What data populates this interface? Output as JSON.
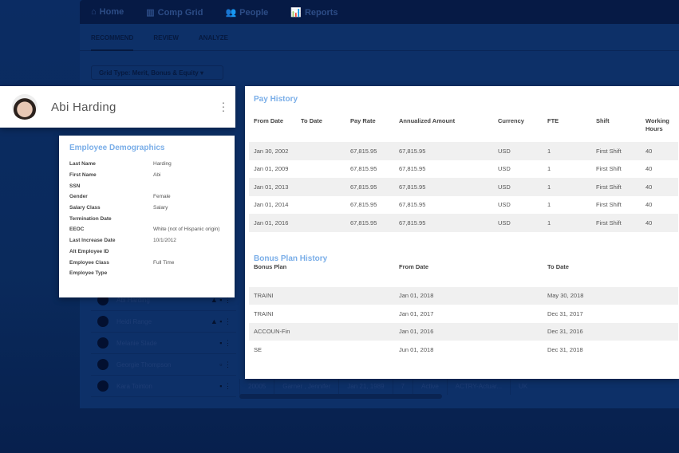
{
  "nav": {
    "items": [
      {
        "icon": "home-icon",
        "label": "Home"
      },
      {
        "icon": "grid-icon",
        "label": "Comp Grid"
      },
      {
        "icon": "people-icon",
        "label": "People"
      },
      {
        "icon": "reports-icon",
        "label": "Reports"
      }
    ]
  },
  "tabs": [
    "RECOMMEND",
    "REVIEW",
    "ANALYZE"
  ],
  "grid_type": "Grid Type: Merit, Bonus & Equity",
  "background_list": [
    "Abi Harding",
    "Heidi Range",
    "Melanie Slade",
    "Georgie Thompson",
    "Kara Tointon"
  ],
  "background_row": [
    "20005",
    "Garner , Jennifer",
    "Jan 21, 1989",
    "7",
    "Active",
    "ACTRY-Actuar...",
    "UK"
  ],
  "profile": {
    "name": "Abi Harding"
  },
  "demographics": {
    "title": "Employee Demographics",
    "rows": [
      {
        "label": "Last Name",
        "value": "Harding"
      },
      {
        "label": "First Name",
        "value": "Abi"
      },
      {
        "label": "SSN",
        "value": ""
      },
      {
        "label": "Gender",
        "value": "Female"
      },
      {
        "label": "Salary Class",
        "value": "Salary"
      },
      {
        "label": "Termination Date",
        "value": ""
      },
      {
        "label": "EEOC",
        "value": "White (not of Hispanic origin)"
      },
      {
        "label": "Last Increase Date",
        "value": "10/1/2012"
      },
      {
        "label": "Alt Employee ID",
        "value": ""
      },
      {
        "label": "Employee Class",
        "value": "Full Time"
      },
      {
        "label": "Employee Type",
        "value": ""
      }
    ]
  },
  "pay_history": {
    "title": "Pay History",
    "columns": [
      "From Date",
      "To Date",
      "Pay Rate",
      "Annualized Amount",
      "Currency",
      "FTE",
      "Shift",
      "Working Hours"
    ],
    "rows": [
      [
        "Jan 30, 2002",
        "",
        "67,815.95",
        "67,815.95",
        "USD",
        "1",
        "First Shift",
        "40"
      ],
      [
        "Jan 01, 2009",
        "",
        "67,815.95",
        "67,815.95",
        "USD",
        "1",
        "First Shift",
        "40"
      ],
      [
        "Jan 01, 2013",
        "",
        "67,815.95",
        "67,815.95",
        "USD",
        "1",
        "First Shift",
        "40"
      ],
      [
        "Jan 01, 2014",
        "",
        "67,815.95",
        "67,815.95",
        "USD",
        "1",
        "First Shift",
        "40"
      ],
      [
        "Jan 01, 2016",
        "",
        "67,815.95",
        "67,815.95",
        "USD",
        "1",
        "First Shift",
        "40"
      ]
    ]
  },
  "bonus_history": {
    "title": "Bonus Plan History",
    "columns": [
      "Bonus Plan",
      "From Date",
      "To Date"
    ],
    "rows": [
      [
        "TRAINI",
        "Jan 01, 2018",
        "May 30, 2018"
      ],
      [
        "TRAINI",
        "Jan 01, 2017",
        "Dec 31, 2017"
      ],
      [
        "ACCOUN-Fin",
        "Jan 01, 2016",
        "Dec 31, 2016"
      ],
      [
        "SE",
        "Jun 01, 2018",
        "Dec 31, 2018"
      ]
    ]
  }
}
